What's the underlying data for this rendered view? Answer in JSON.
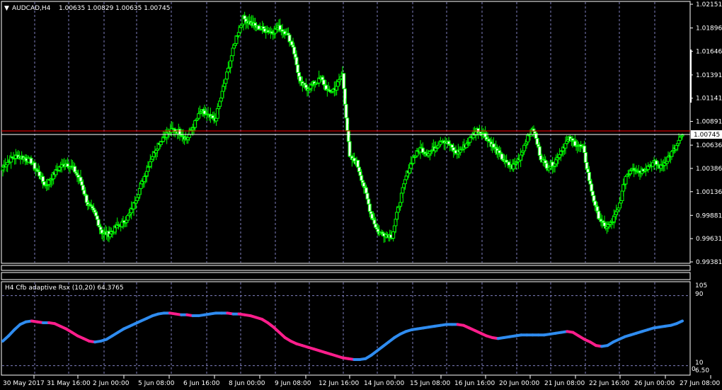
{
  "chart_header": {
    "symbol_tf": "AUDCAD,H4",
    "ohlc": "1.00635 1.00829 1.00635 1.00745",
    "arrow_glyph": "▼"
  },
  "indicator_header": "H4 Cfb adaptive Rsx (10,20) 64.3765",
  "colors": {
    "background": "#000000",
    "frame": "#ffffff",
    "bull": "#00ff00",
    "bear_fill": "#ffffff",
    "grid": "#8080c0",
    "bid_line": "#ff0000",
    "ask_line": "#ffffff",
    "rsx_up": "#2f8cf0",
    "rsx_down": "#ff1e8c"
  },
  "chart_data": [
    {
      "type": "candlestick",
      "title": "AUDCAD,H4",
      "ylim": [
        0.99381,
        1.02151
      ],
      "y_ticks": [
        "1.02151",
        "1.01896",
        "1.01646",
        "1.01391",
        "1.01141",
        "1.00891",
        "1.00636",
        "1.00386",
        "1.00136",
        "0.99881",
        "0.99631",
        "0.99381"
      ],
      "current_price_label": "1.00745",
      "bid_line": 1.00745,
      "ask_line": 1.0077,
      "x_tick_labels": [
        "30 May 2017",
        "31 May 16:00",
        "2 Jun 00:00",
        "5 Jun 08:00",
        "6 Jun 16:00",
        "8 Jun 00:00",
        "9 Jun 08:00",
        "12 Jun 16:00",
        "14 Jun 00:00",
        "15 Jun 08:00",
        "16 Jun 16:00",
        "20 Jun 00:00",
        "21 Jun 08:00",
        "22 Jun 16:00",
        "26 Jun 00:00",
        "27 Jun 08:00"
      ],
      "close_path": [
        1.004,
        1.0048,
        1.0052,
        1.005,
        1.0046,
        1.0034,
        1.002,
        1.003,
        1.004,
        1.0044,
        1.0038,
        1.0025,
        1.0,
        0.999,
        0.997,
        0.9968,
        0.9975,
        0.998,
        0.999,
        1.001,
        1.003,
        1.005,
        1.0065,
        1.0075,
        1.008,
        1.0078,
        1.007,
        1.0085,
        1.01,
        1.0095,
        1.009,
        1.012,
        1.015,
        1.018,
        1.02,
        1.0195,
        1.019,
        1.0188,
        1.0185,
        1.019,
        1.0185,
        1.017,
        1.013,
        1.0125,
        1.013,
        1.0135,
        1.012,
        1.0125,
        1.014,
        1.005,
        1.0045,
        1.002,
        0.999,
        0.997,
        0.9968,
        0.9966,
        1.0,
        1.003,
        1.005,
        1.006,
        1.0055,
        1.006,
        1.007,
        1.0065,
        1.0055,
        1.006,
        1.007,
        1.008,
        1.0075,
        1.0065,
        1.0055,
        1.0045,
        1.004,
        1.005,
        1.007,
        1.008,
        1.005,
        1.004,
        1.0045,
        1.006,
        1.007,
        1.0065,
        1.006,
        1.002,
        0.999,
        0.9975,
        0.998,
        0.9995,
        1.003,
        1.004,
        1.0035,
        1.004,
        1.0045,
        1.004,
        1.005,
        1.006,
        1.00745
      ]
    },
    {
      "type": "line",
      "title": "H4 Cfb adaptive Rsx (10,20) 64.3765",
      "ylim": [
        0,
        105
      ],
      "y_ticks": [
        "105",
        "90",
        "10",
        "6.50",
        "0"
      ],
      "levels": [
        90,
        10
      ],
      "last_value": 64.3765,
      "rsx_values": [
        38,
        44,
        51,
        57,
        60,
        61,
        60,
        59,
        59,
        58,
        55,
        52,
        48,
        44,
        41,
        38,
        37,
        38,
        40,
        44,
        48,
        52,
        55,
        58,
        61,
        64,
        67,
        69,
        70,
        70,
        69,
        68,
        68,
        67,
        67,
        68,
        69,
        70,
        70,
        70,
        69,
        69,
        68,
        67,
        65,
        63,
        59,
        54,
        48,
        42,
        38,
        35,
        33,
        31,
        29,
        27,
        25,
        23,
        21,
        19,
        18,
        17,
        17,
        18,
        22,
        27,
        32,
        37,
        42,
        46,
        49,
        51,
        52,
        53,
        54,
        55,
        56,
        57,
        57,
        57,
        56,
        53,
        50,
        47,
        44,
        42,
        41,
        42,
        43,
        44,
        45,
        45,
        45,
        45,
        45,
        46,
        47,
        48,
        49,
        48,
        44,
        40,
        37,
        33,
        32,
        33,
        37,
        40,
        43,
        45,
        47,
        49,
        51,
        53,
        54,
        55,
        56,
        58,
        61
      ]
    }
  ]
}
